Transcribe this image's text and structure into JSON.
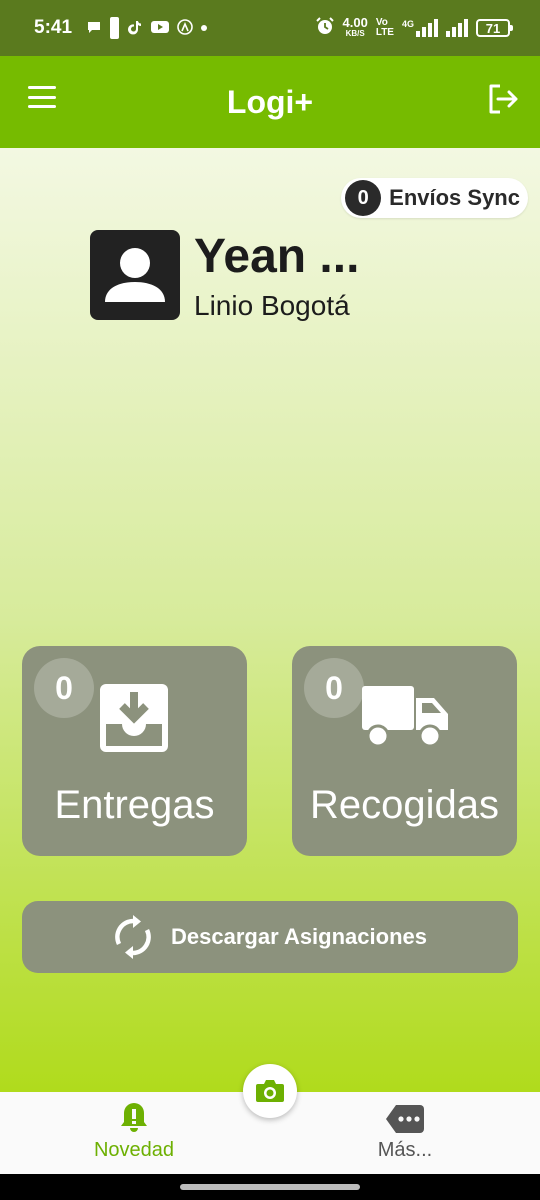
{
  "status_bar": {
    "time": "5:41",
    "net_speed": "4.00",
    "net_unit": "KB/S",
    "volte_top": "Vo",
    "volte_bottom": "LTE",
    "network_type": "4G",
    "battery": "71"
  },
  "app_bar": {
    "title": "Logi+"
  },
  "sync": {
    "count": "0",
    "label": "Envíos Sync"
  },
  "profile": {
    "name": "Yean ...",
    "branch": "Linio Bogotá"
  },
  "tiles": {
    "entregas": {
      "count": "0",
      "label": "Entregas"
    },
    "recogidas": {
      "count": "0",
      "label": "Recogidas"
    }
  },
  "download_button": {
    "label": "Descargar Asignaciones"
  },
  "bottom_nav": {
    "items": [
      {
        "label": "Novedad",
        "icon": "bell-alert-icon",
        "active": true
      },
      {
        "label": "Más...",
        "icon": "more-tag-icon",
        "active": false
      }
    ]
  },
  "colors": {
    "primary": "#76bb00",
    "status_bar": "#5a7a1e",
    "tile": "#8c927d",
    "active_nav": "#6db002"
  }
}
